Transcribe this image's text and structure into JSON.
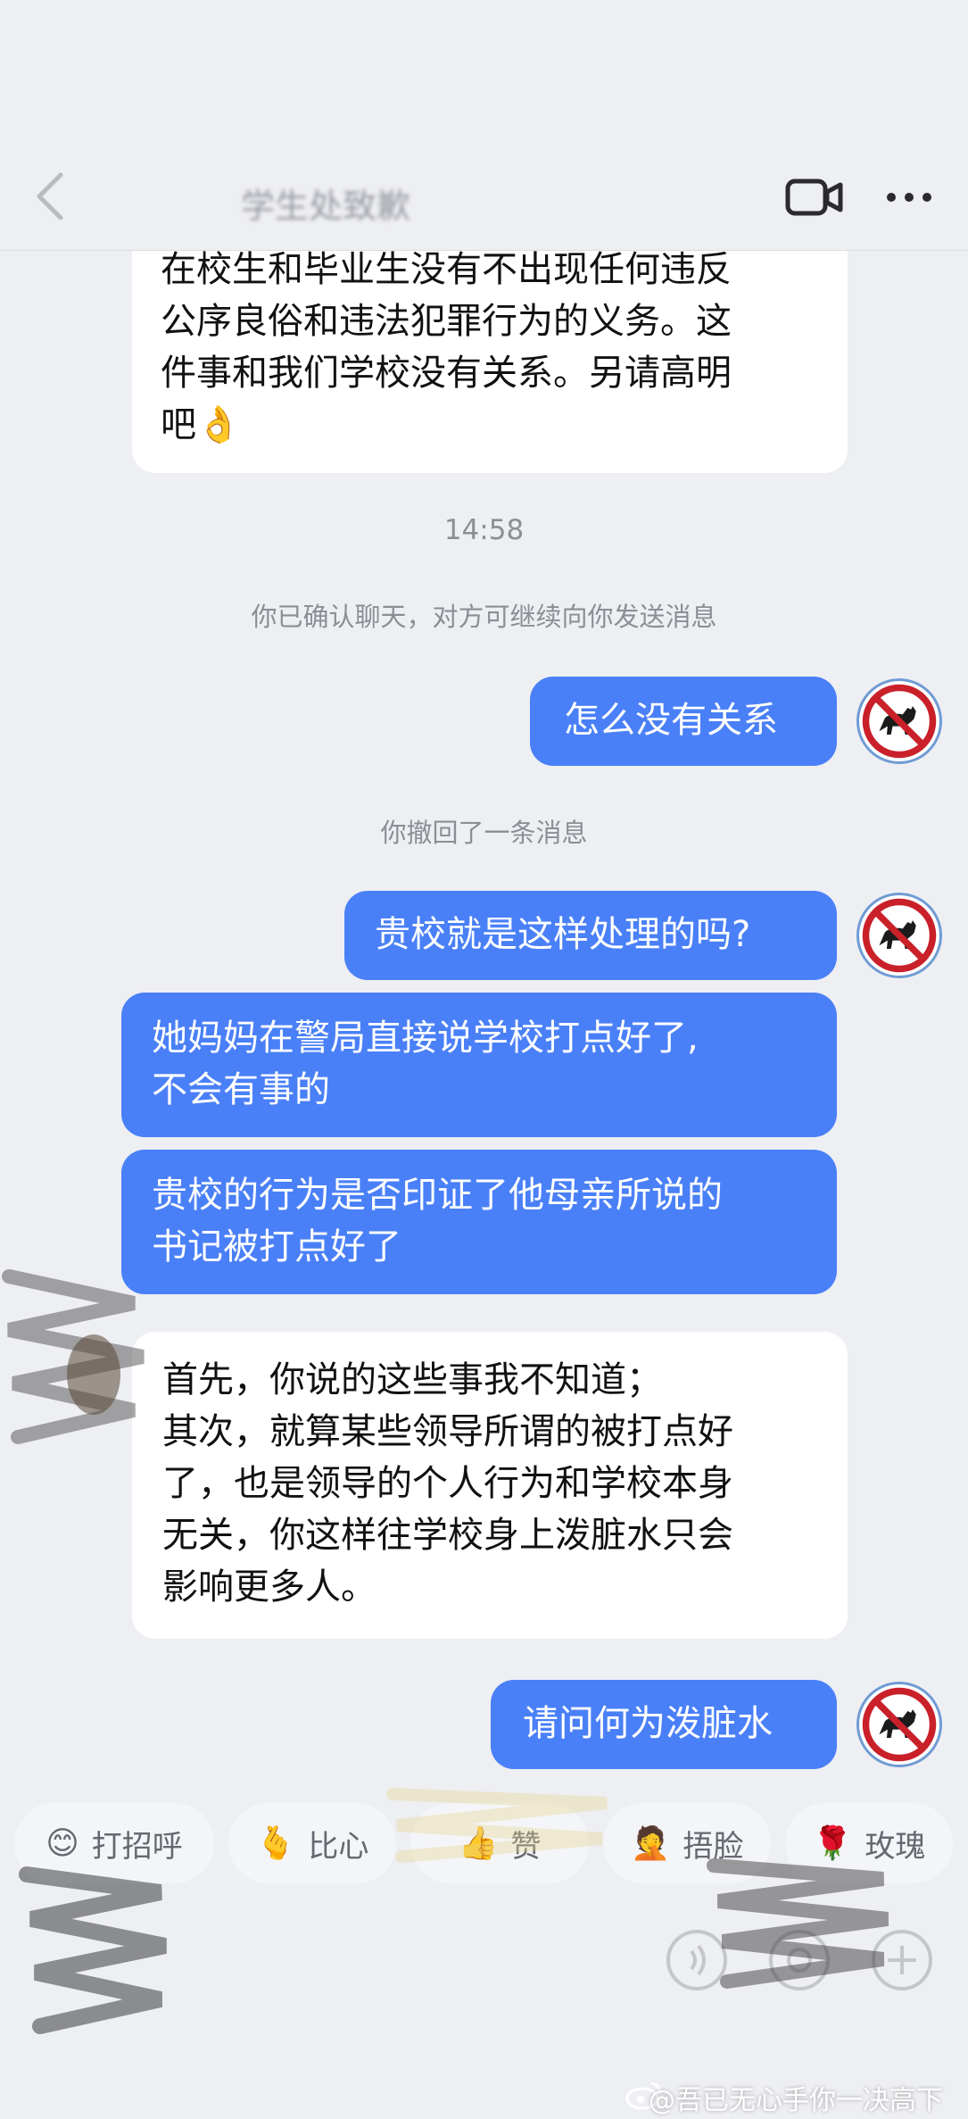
{
  "header": {
    "title": "学生处致歉",
    "icons": {
      "back": "chevron-left-icon",
      "video": "video-call-icon",
      "more": "more-dots-icon"
    }
  },
  "messages": [
    {
      "side": "in",
      "text": "在校生和毕业生没有不出现任何违反\n公序良俗和违法犯罪行为的义务。这\n件事和我们学校没有关系。另请高明\n吧👌"
    },
    {
      "side": "out",
      "text": "怎么没有关系"
    },
    {
      "side": "out",
      "text": "贵校就是这样处理的吗?"
    },
    {
      "side": "out",
      "text": "她妈妈在警局直接说学校打点好了,\n不会有事的"
    },
    {
      "side": "out",
      "text": "贵校的行为是否印证了他母亲所说的\n书记被打点好了"
    },
    {
      "side": "in",
      "text": "首先，你说的这些事我不知道；\n其次，就算某些领导所谓的被打点好\n了，也是领导的个人行为和学校本身\n无关，你这样往学校身上泼脏水只会\n影响更多人。"
    },
    {
      "side": "out",
      "text": "请问何为泼脏水"
    }
  ],
  "system": {
    "timestamp": "14:58",
    "confirmed_note": "你已确认聊天，对方可继续向你发送消息",
    "recalled_note": "你撤回了一条消息"
  },
  "quick_replies": [
    {
      "emoji": "😊",
      "label": "打招呼"
    },
    {
      "emoji": "🫰",
      "label": "比心"
    },
    {
      "emoji": "👍",
      "label": "赞"
    },
    {
      "emoji": "🤦",
      "label": "捂脸"
    },
    {
      "emoji": "🌹",
      "label": "玫瑰"
    }
  ],
  "avatar_icon": "no-dog-sign-icon",
  "watermark": "@吾已无心手你一决高下",
  "colors": {
    "outgoing": "#4a80f7",
    "incoming": "#ffffff",
    "background": "#eeeff3"
  }
}
